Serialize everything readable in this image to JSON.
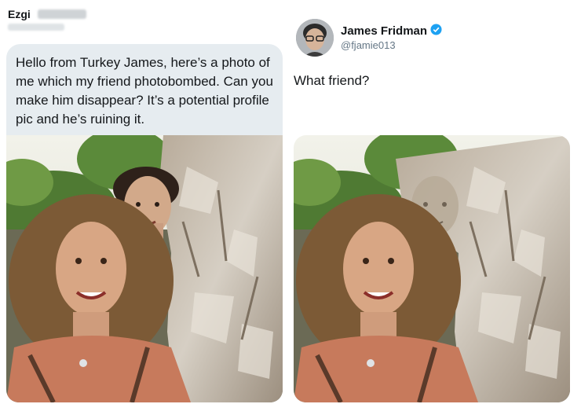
{
  "left_tweet": {
    "author_name": "Ezgi",
    "message": "Hello from Turkey James, here’s a photo of me which my friend photobombed. Can you make him disappear? It’s a potential profile pic and he’s ruining it."
  },
  "right_tweet": {
    "author_name": "James Fridman",
    "handle": "@fjamie013",
    "verified_icon": "verified-badge-icon",
    "verified_color": "#1da1f2",
    "reply": "What friend?"
  },
  "colors": {
    "bubble_bg": "#e6ecf0",
    "handle_gray": "#657786"
  }
}
